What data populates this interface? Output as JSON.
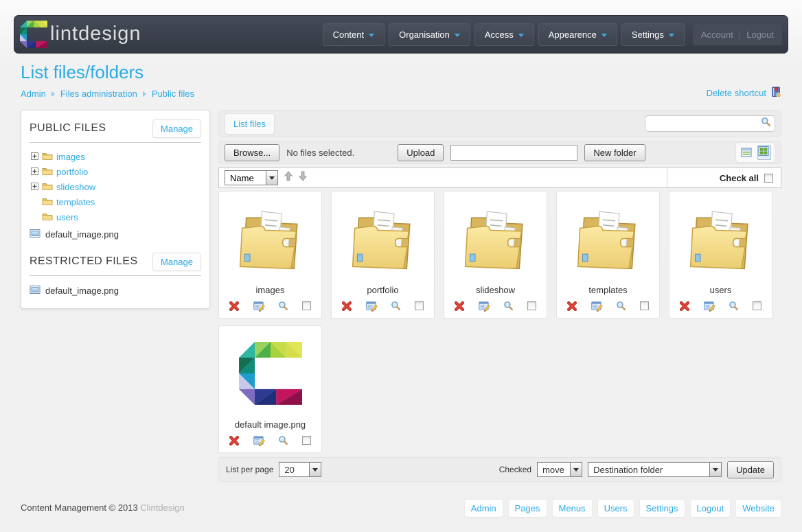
{
  "colors": {
    "accent_blue": "#2dabe3",
    "header_bg": "#3a404b",
    "toolbar_gray": "#ececec",
    "delete_red": "#e2463a",
    "folder_yellow": "#f0d180"
  },
  "icons": {
    "brand_logo": "mosaic-c",
    "search": "magnifier",
    "delete": "red-x",
    "edit": "form-with-pencil",
    "preview": "magnifier",
    "view_table": "table-list",
    "view_grid": "thumbnail-grid",
    "delete_shortcut": "book-with-minus-badge",
    "sort_ascending": "block-arrow-up",
    "sort_descending": "block-arrow-down",
    "folder": "yellow-folder-with-documents",
    "image_file": "framed-picture",
    "tree_expander": "plus-box",
    "nav_caret": "blue-triangle-down"
  },
  "header": {
    "brand": "lintdesign",
    "nav": [
      {
        "label": "Content"
      },
      {
        "label": "Organisation"
      },
      {
        "label": "Access"
      },
      {
        "label": "Appearence"
      },
      {
        "label": "Settings"
      }
    ],
    "account_label": "Account",
    "separator": "|",
    "logout_label": "Logout"
  },
  "page": {
    "title": "List files/folders",
    "breadcrumb": [
      {
        "label": "Admin"
      },
      {
        "label": "Files administration"
      },
      {
        "label": "Public files"
      }
    ],
    "delete_shortcut_label": "Delete shortcut"
  },
  "sidebar": {
    "public": {
      "title": "PUBLIC FILES",
      "manage_label": "Manage",
      "folders": [
        {
          "label": "images",
          "expandable": true
        },
        {
          "label": "portfolio",
          "expandable": true
        },
        {
          "label": "slideshow",
          "expandable": true
        },
        {
          "label": "templates",
          "expandable": false
        },
        {
          "label": "users",
          "expandable": false
        }
      ],
      "file": "default_image.png"
    },
    "restricted": {
      "title": "RESTRICTED FILES",
      "manage_label": "Manage",
      "file": "default_image.png"
    }
  },
  "main": {
    "tab_label": "List files",
    "search": {
      "value": "",
      "placeholder": ""
    },
    "toolbar": {
      "browse_label": "Browse...",
      "no_files_text": "No files selected.",
      "upload_label": "Upload",
      "folder_input_value": "",
      "new_folder_label": "New folder"
    },
    "sort": {
      "field": "Name",
      "check_all_label": "Check all"
    },
    "files": [
      {
        "name": "images",
        "type": "folder"
      },
      {
        "name": "portfolio",
        "type": "folder"
      },
      {
        "name": "slideshow",
        "type": "folder"
      },
      {
        "name": "templates",
        "type": "folder"
      },
      {
        "name": "users",
        "type": "folder"
      },
      {
        "name": "default image.png",
        "type": "image"
      }
    ],
    "pagination": {
      "list_per_page_label": "List per page",
      "per_page_value": "20",
      "checked_label": "Checked",
      "action_value": "move",
      "destination_value": "Destination folder",
      "update_label": "Update"
    }
  },
  "footer": {
    "copyright": "Content Management © 2013",
    "brand": "Clintdesign",
    "links": [
      {
        "label": "Admin"
      },
      {
        "label": "Pages"
      },
      {
        "label": "Menus"
      },
      {
        "label": "Users"
      },
      {
        "label": "Settings"
      },
      {
        "label": "Logout"
      },
      {
        "label": "Website"
      }
    ]
  }
}
